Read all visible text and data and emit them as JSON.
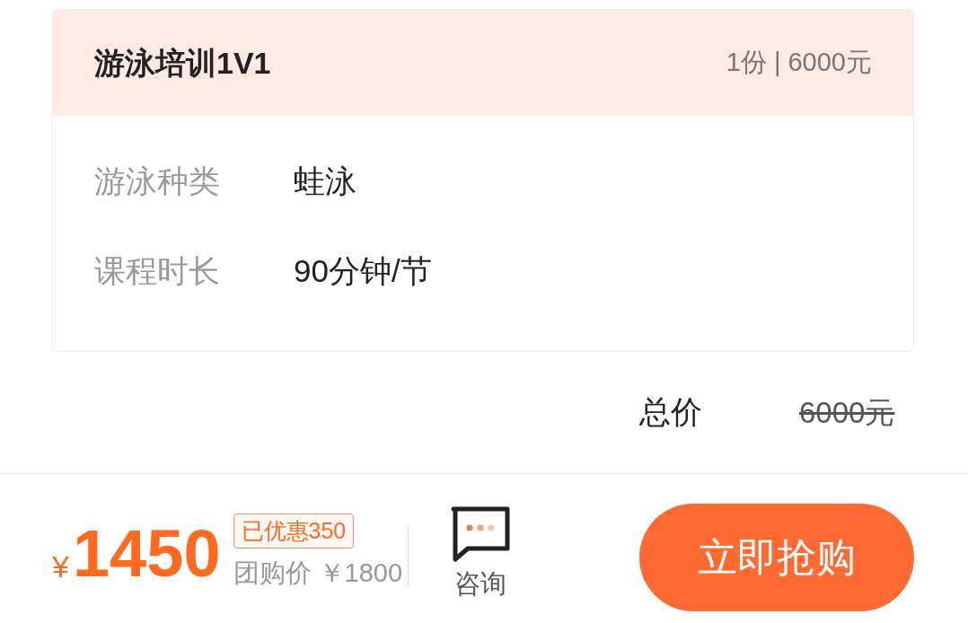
{
  "package": {
    "title": "游泳培训1V1",
    "summary": "1份 | 6000元",
    "attributes": [
      {
        "label": "游泳种类",
        "value": "蛙泳"
      },
      {
        "label": "课程时长",
        "value": "90分钟/节"
      }
    ]
  },
  "total": {
    "label": "总价",
    "price": "6000元",
    "struck": true
  },
  "bottom_bar": {
    "currency": "¥",
    "price": "1450",
    "discount_badge": "已优惠350",
    "group_price": "团购价 ￥1800",
    "consult": "咨询",
    "buy_button": "立即抢购"
  }
}
